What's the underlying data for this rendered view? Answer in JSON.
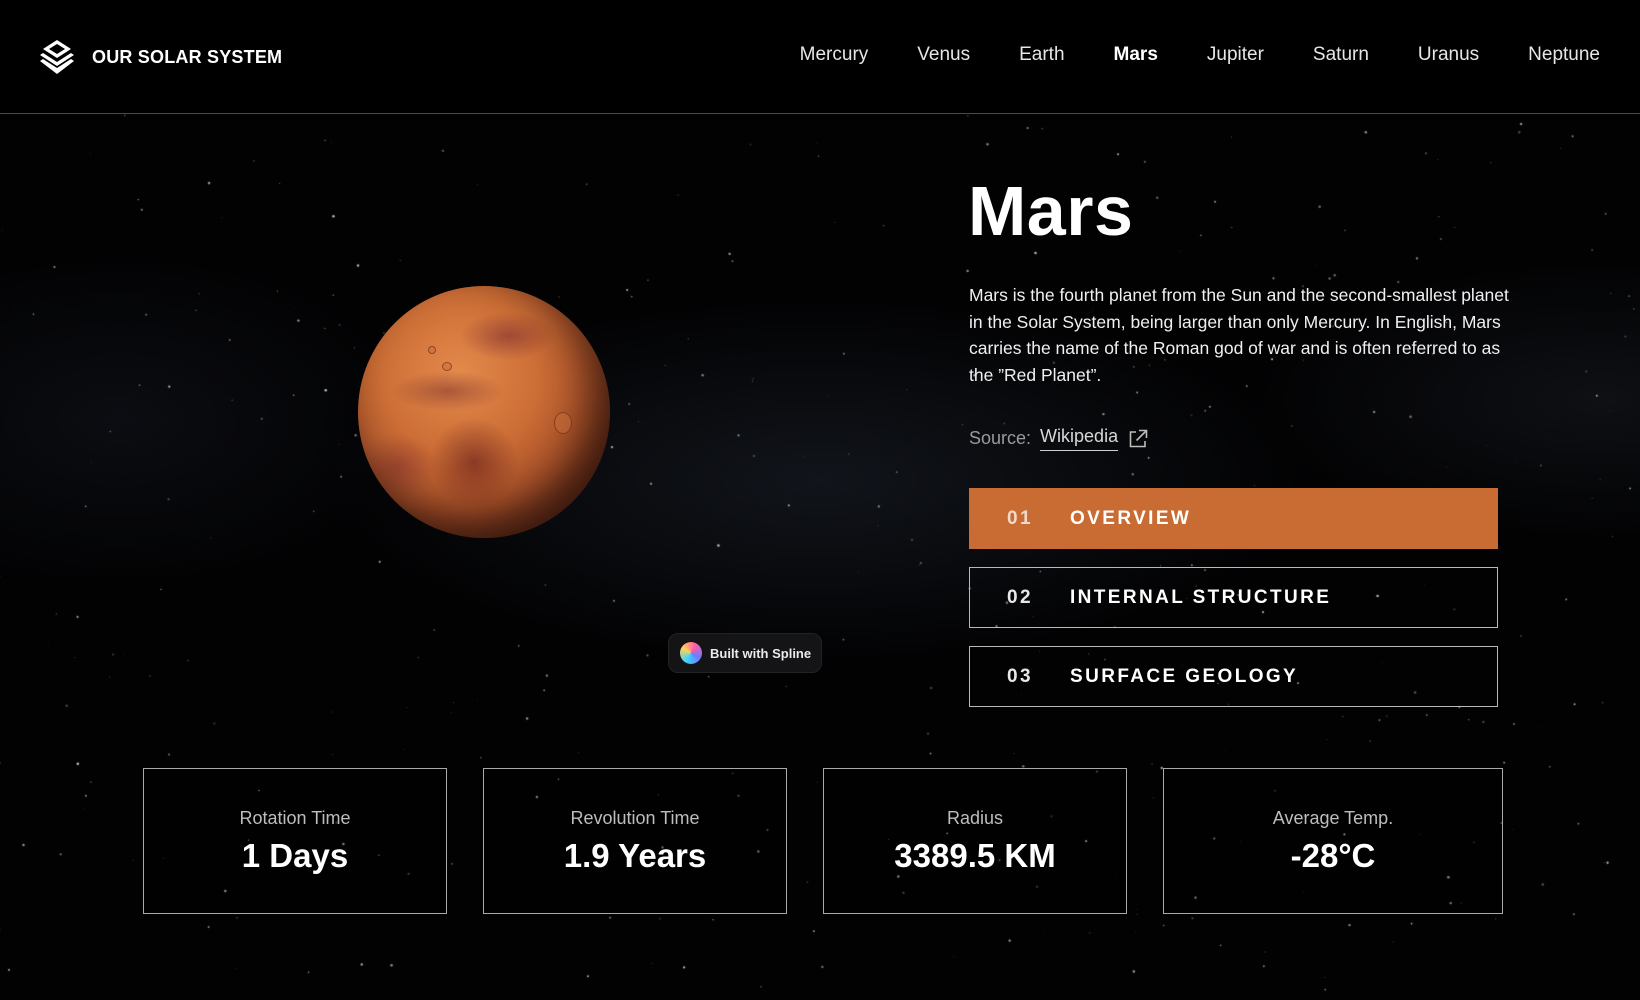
{
  "header": {
    "brand": "OUR SOLAR SYSTEM",
    "nav": [
      {
        "label": "Mercury"
      },
      {
        "label": "Venus"
      },
      {
        "label": "Earth"
      },
      {
        "label": "Mars"
      },
      {
        "label": "Jupiter"
      },
      {
        "label": "Saturn"
      },
      {
        "label": "Uranus"
      },
      {
        "label": "Neptune"
      }
    ],
    "active_nav": "Mars"
  },
  "planet": {
    "name": "Mars",
    "description": "Mars is the fourth planet from the Sun and the second-smallest planet in the Solar System, being larger than only Mercury. In English, Mars carries the name of the Roman god of war and is often referred to as the ”Red Planet”.",
    "source_label": "Source:",
    "source_link": "Wikipedia",
    "color": "#c86c33"
  },
  "tabs": [
    {
      "num": "01",
      "label": "OVERVIEW",
      "active": true
    },
    {
      "num": "02",
      "label": "INTERNAL STRUCTURE",
      "active": false
    },
    {
      "num": "03",
      "label": "SURFACE GEOLOGY",
      "active": false
    }
  ],
  "badge": {
    "label": "Built with Spline"
  },
  "stats": [
    {
      "label": "Rotation Time",
      "value": "1 Days"
    },
    {
      "label": "Revolution Time",
      "value": "1.9 Years"
    },
    {
      "label": "Radius",
      "value": "3389.5 KM"
    },
    {
      "label": "Average Temp.",
      "value": "-28°C"
    }
  ],
  "icons": {
    "brand": "solar-system-logo-icon",
    "source": "external-link-icon",
    "badge": "spline-logo-icon"
  }
}
